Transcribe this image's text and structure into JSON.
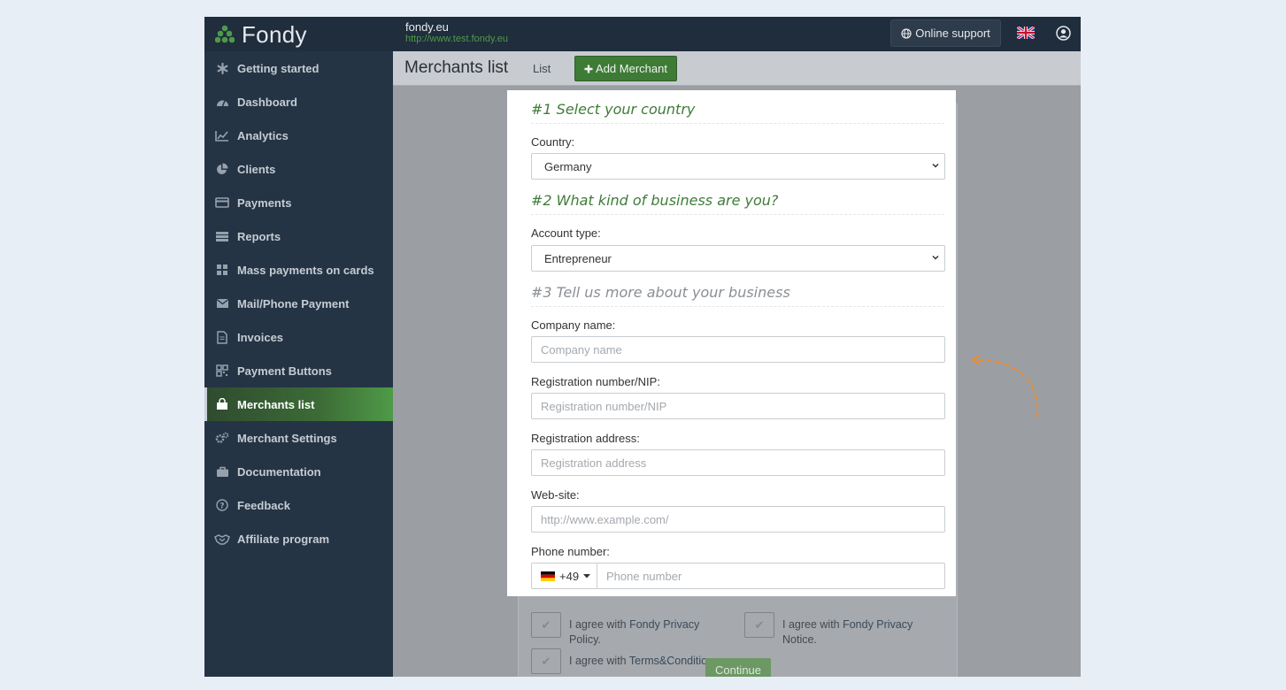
{
  "topbar": {
    "logo_text": "Fondy",
    "site_name": "fondy.eu",
    "site_url": "http://www.test.fondy.eu",
    "support_label": "Online support"
  },
  "sidebar": {
    "items": [
      {
        "label": "Getting started",
        "icon": "asterisk-icon"
      },
      {
        "label": "Dashboard",
        "icon": "dashboard-icon"
      },
      {
        "label": "Analytics",
        "icon": "line-chart-icon"
      },
      {
        "label": "Clients",
        "icon": "pie-chart-icon"
      },
      {
        "label": "Payments",
        "icon": "credit-card-icon"
      },
      {
        "label": "Reports",
        "icon": "server-icon"
      },
      {
        "label": "Mass payments on cards",
        "icon": "grid-icon"
      },
      {
        "label": "Mail/Phone Payment",
        "icon": "envelope-icon"
      },
      {
        "label": "Invoices",
        "icon": "file-icon"
      },
      {
        "label": "Payment Buttons",
        "icon": "qr-code-icon"
      },
      {
        "label": "Merchants list",
        "icon": "shopping-bag-icon"
      },
      {
        "label": "Merchant Settings",
        "icon": "gears-icon"
      },
      {
        "label": "Documentation",
        "icon": "briefcase-icon"
      },
      {
        "label": "Feedback",
        "icon": "question-circle-icon"
      },
      {
        "label": "Affiliate program",
        "icon": "handshake-icon"
      }
    ],
    "active": "Merchants list"
  },
  "header": {
    "title": "Merchants list",
    "tab_list": "List",
    "add_button": "Add Merchant"
  },
  "form": {
    "section1": "#1 Select your country",
    "country_label": "Country:",
    "country_value": "Germany",
    "section2": "#2 What kind of business are you?",
    "account_type_label": "Account type:",
    "account_type_value": "Entrepreneur",
    "section3": "#3 Tell us more about your business",
    "company_label": "Company name:",
    "company_placeholder": "Company name",
    "regnum_label": "Registration number/NIP:",
    "regnum_placeholder": "Registration number/NIP",
    "regaddr_label": "Registration address:",
    "regaddr_placeholder": "Registration address",
    "website_label": "Web-site:",
    "website_placeholder": "http://www.example.com/",
    "phone_label": "Phone number:",
    "phone_prefix": "+49",
    "phone_placeholder": "Phone number"
  },
  "behind": {
    "agree_privacy_policy_prefix": "I agree with ",
    "agree_privacy_policy_link": "Fondy Privacy",
    "agree_privacy_policy_suffix": "Policy.",
    "agree_privacy_notice_prefix": "I agree with ",
    "agree_privacy_notice_link": "Fondy Privacy",
    "agree_privacy_notice_suffix": "Notice.",
    "agree_terms_prefix": "I agree with ",
    "agree_terms_link": "Terms&Conditions.",
    "continue_label": "Continue"
  },
  "colors": {
    "brand_green": "#4f9a48",
    "sidebar_bg": "#243445",
    "topbar_bg": "#1f2d3d",
    "annotation_arrow": "#f08a24"
  }
}
